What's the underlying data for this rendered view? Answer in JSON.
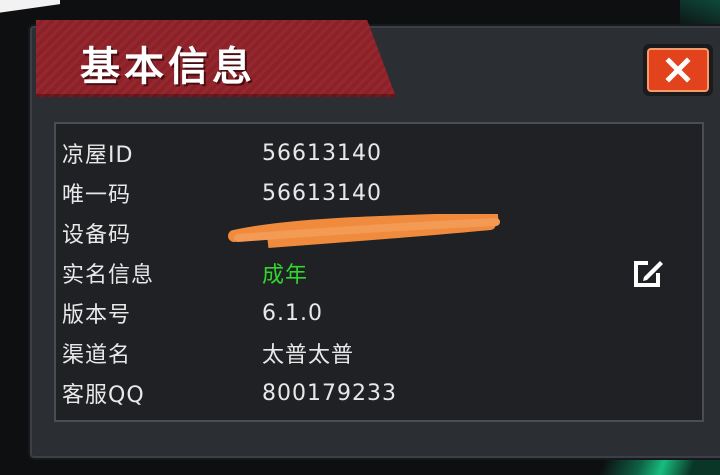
{
  "dialog": {
    "title": "基本信息",
    "close_icon": "close-icon"
  },
  "info_rows": [
    {
      "label": "凉屋ID",
      "value": "56613140"
    },
    {
      "label": "唯一码",
      "value": "56613140"
    },
    {
      "label": "设备码",
      "value": ""
    },
    {
      "label": "实名信息",
      "value": "成年"
    },
    {
      "label": "版本号",
      "value": "6.1.0"
    },
    {
      "label": "渠道名",
      "value": "太普太普"
    },
    {
      "label": "客服QQ",
      "value": "800179233"
    }
  ],
  "colors": {
    "title_bg": "#8e2128",
    "close_button": "#e2421c",
    "panel_bg": "#2b2e33",
    "verified_text": "#2fd62f",
    "redaction": "#f08a3c"
  },
  "icons": {
    "edit": "edit-icon"
  }
}
